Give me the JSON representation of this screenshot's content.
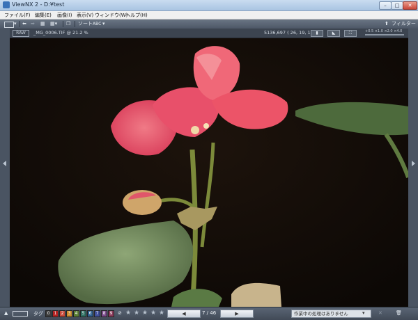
{
  "window": {
    "title": "ViewNX 2 - D:¥test",
    "min": "–",
    "max": "□",
    "close": "✕"
  },
  "menu": [
    "ファイル(F)",
    "編集(E)",
    "画像(I)",
    "表示(V)",
    "ウィンドウ(W)",
    "ヘルプ(H)"
  ],
  "toolbar": {
    "sort_label": "ソート",
    "sort_value": "ABC",
    "filter_label": "フィルター"
  },
  "info": {
    "raw_badge": "RAW",
    "file_info": "_MG_0006.TIF @ 21.2 %",
    "coord_info": "5136,697 (  26, 19, 15 )",
    "zoom_scale": "+0.5  ×1.0  ×2.0  ×4.0"
  },
  "bottom": {
    "tag_label": "タグ",
    "label_numbers": [
      "0",
      "1",
      "2",
      "3",
      "4",
      "5",
      "6",
      "7",
      "8",
      "9"
    ],
    "label_colors": [
      "#3b3b3b",
      "#b22222",
      "#c84a3a",
      "#c98a2a",
      "#5b7f34",
      "#2f6f63",
      "#2e5f8f",
      "#3f4f9a",
      "#7a4a8a",
      "#8a3a5a"
    ],
    "stars": [
      "★",
      "★",
      "★",
      "★",
      "★"
    ],
    "prev_icon": "◀",
    "next_icon": "▶",
    "page": "7 / 46",
    "status": "作業中の処理はありません"
  },
  "icons": [
    "app-icon",
    "back-arrow-icon",
    "forward-arrow-icon",
    "grid-icon",
    "trash-icon",
    "filter-icon",
    "no-rating-icon",
    "panel-arrow-icon"
  ],
  "colors": {
    "background": "#110b07",
    "petal": "#e8506a",
    "stem": "#7a8a3a",
    "leaf": "#6f8a5a"
  }
}
